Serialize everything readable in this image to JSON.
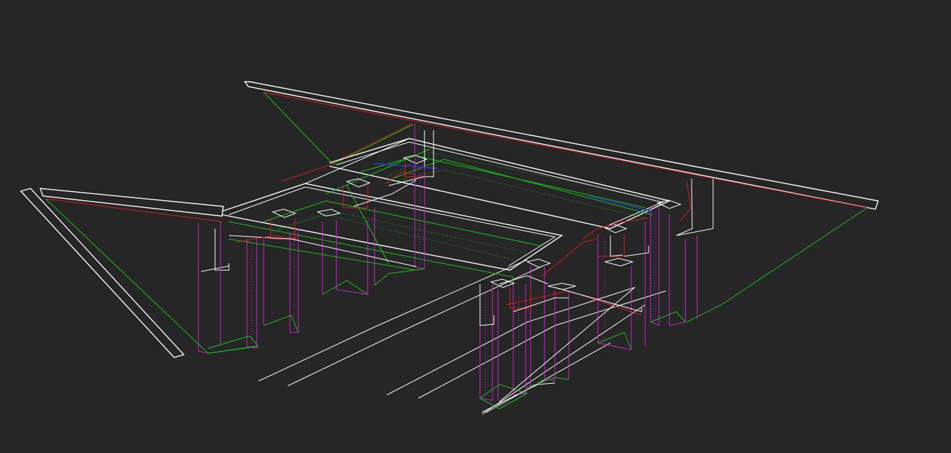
{
  "viewport": {
    "background": "#262626",
    "colors": {
      "edge": "#ffffff",
      "edge_red": "#e01a1a",
      "edge_green": "#17c41d",
      "edge_magenta": "#d21fd2",
      "edge_blue": "#2a36e0"
    }
  }
}
